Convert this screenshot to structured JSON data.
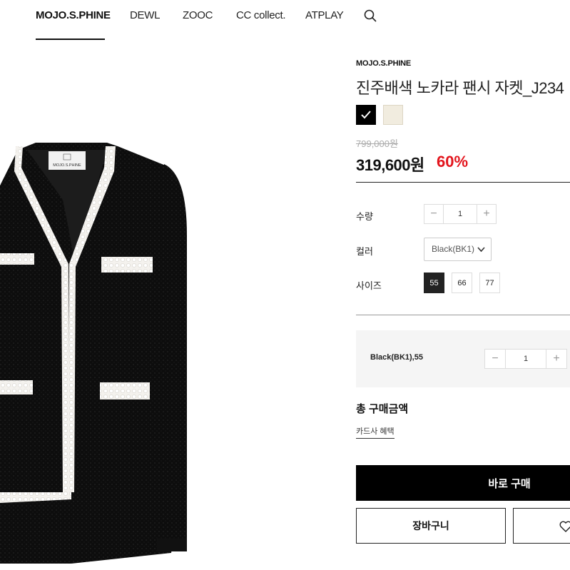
{
  "nav": {
    "items": [
      {
        "label": "MOJO.S.PHINE",
        "active": true
      },
      {
        "label": "DEWL"
      },
      {
        "label": "ZOOC"
      },
      {
        "label": "CC collect."
      },
      {
        "label": "ATPLAY"
      }
    ],
    "search_icon": "search-icon"
  },
  "product": {
    "brand": "MOJO.S.PHINE",
    "title": "진주배색 노카라 팬시 자켓_J234",
    "label_text": "MOJO.S.PHINE",
    "swatches": [
      {
        "name": "Black",
        "color": "#000000",
        "selected": true
      },
      {
        "name": "Ivory",
        "color": "#f1ecdf",
        "selected": false
      }
    ],
    "original_price": "799,000원",
    "sale_price": "319,600원",
    "discount": "60%"
  },
  "options": {
    "quantity_label": "수량",
    "quantity_value": "1",
    "color_label": "컬러",
    "color_value": "Black(BK1)",
    "size_label": "사이즈",
    "sizes": [
      {
        "label": "55",
        "selected": true
      },
      {
        "label": "66",
        "selected": false
      },
      {
        "label": "77",
        "selected": false
      }
    ]
  },
  "summary": {
    "item_label": "Black(BK1),55",
    "quantity_value": "1"
  },
  "total": {
    "label": "총 구매금액",
    "card_link": "카드사 혜택"
  },
  "actions": {
    "buy_label": "바로 구매",
    "cart_label": "장바구니",
    "wish_icon": "heart-icon"
  },
  "colors": {
    "discount": "#e3141c",
    "primary": "#000000"
  }
}
